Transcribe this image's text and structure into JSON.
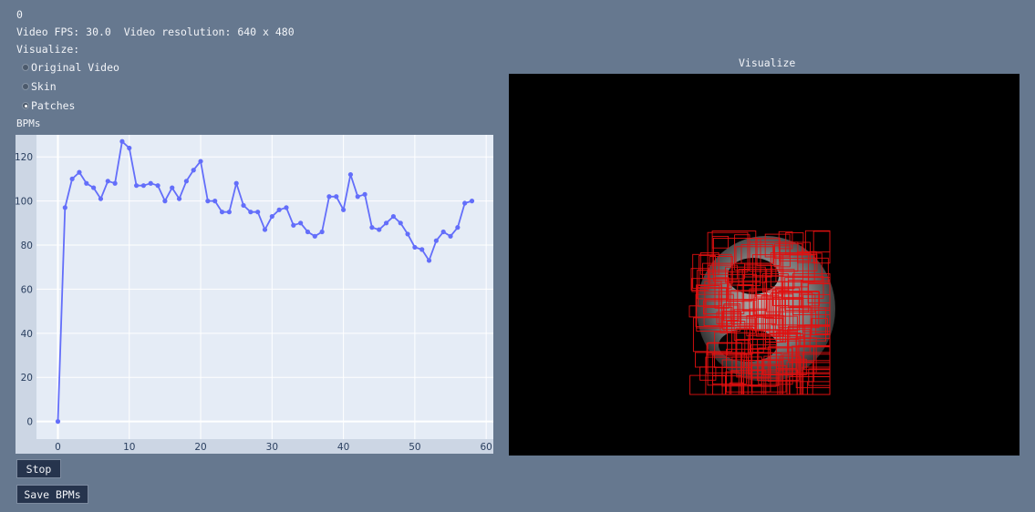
{
  "status": {
    "frame_counter": "0",
    "video_info": "Video FPS: 30.0  Video resolution: 640 x 480"
  },
  "visualize": {
    "label": "Visualize:",
    "options": [
      {
        "label": "Original Video",
        "checked": false
      },
      {
        "label": "Skin",
        "checked": false
      },
      {
        "label": "Patches",
        "checked": true
      }
    ]
  },
  "bpm_chart_title": "BPMs",
  "chart_data": {
    "type": "line",
    "title": "BPMs",
    "xlabel": "",
    "ylabel": "",
    "xlim": [
      -3,
      61
    ],
    "ylim": [
      -8,
      130
    ],
    "x_ticks": [
      "0",
      "10",
      "20",
      "30",
      "40",
      "50",
      "60"
    ],
    "y_ticks": [
      "0",
      "20",
      "40",
      "60",
      "80",
      "100",
      "120"
    ],
    "grid": true,
    "line_color": "#636efa",
    "background_color": "#e5ecf6",
    "series": [
      {
        "x": [
          0,
          1,
          2,
          3,
          4,
          5,
          6,
          7,
          8,
          9,
          10,
          11,
          12,
          13,
          14,
          15,
          16,
          17,
          18,
          19,
          20,
          21,
          22,
          23,
          24,
          25,
          26,
          27,
          28,
          29,
          30,
          31,
          32,
          33,
          34,
          35,
          36,
          37,
          38,
          39,
          40,
          41,
          42,
          43,
          44,
          45,
          46,
          47,
          48,
          49,
          50,
          51,
          52,
          53,
          54,
          55,
          56,
          57,
          58
        ],
        "values": [
          0,
          97,
          110,
          113,
          108,
          106,
          101,
          109,
          108,
          127,
          124,
          107,
          107,
          108,
          107,
          100,
          106,
          101,
          109,
          114,
          118,
          100,
          100,
          95,
          95,
          108,
          98,
          95,
          95,
          87,
          93,
          96,
          97,
          89,
          90,
          86,
          84,
          86,
          102,
          102,
          96,
          112,
          102,
          103,
          88,
          87,
          90,
          93,
          90,
          85,
          79,
          78,
          73,
          82,
          86,
          84,
          88,
          99,
          100
        ]
      }
    ]
  },
  "video_panel": {
    "title": "Visualize"
  },
  "buttons": {
    "stop": "Stop",
    "save": "Save BPMs"
  }
}
